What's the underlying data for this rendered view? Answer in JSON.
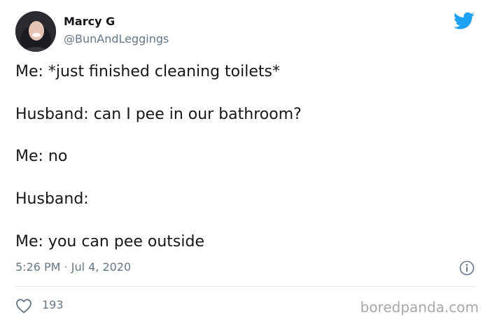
{
  "tweet": {
    "author": {
      "name": "Marcy G",
      "handle": "@BunAndLeggings"
    },
    "lines": [
      "Me: *just finished cleaning toilets*",
      "Husband: can I pee in our bathroom?",
      "Me: no",
      "Husband:",
      "Me: you can pee outside"
    ],
    "timestamp": "5:26 PM · Jul 4, 2020",
    "likes": "193"
  },
  "watermark": "boredpanda.com",
  "colors": {
    "twitter_blue": "#1da1f2",
    "secondary_text": "#657786",
    "divider": "#e1e8ed"
  }
}
